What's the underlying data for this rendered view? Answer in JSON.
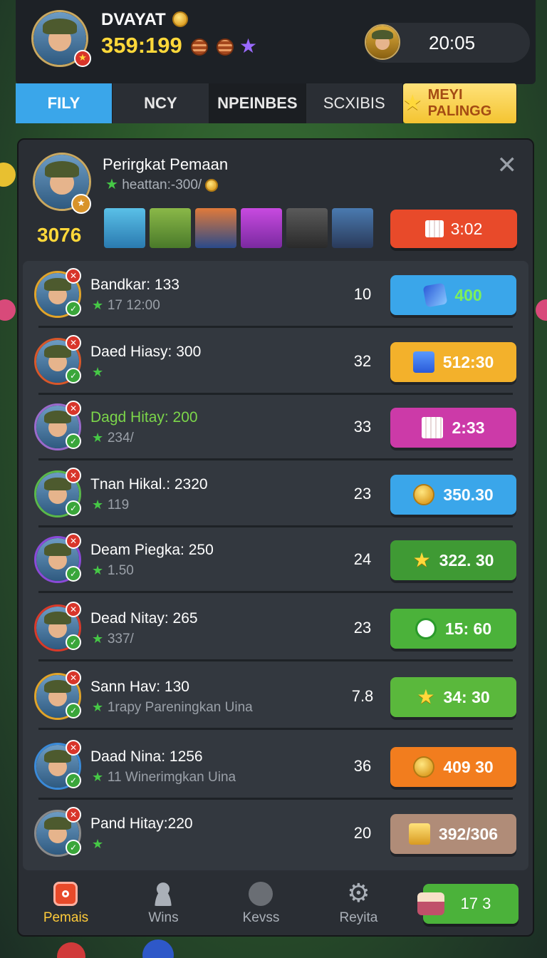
{
  "player": {
    "name": "DVAYAT",
    "balance": "359:199",
    "timer": "20:05"
  },
  "tabs": [
    {
      "label": "FILY",
      "active": true
    },
    {
      "label": "NCY"
    },
    {
      "label": "NPEINBES"
    },
    {
      "label": "SCXIBIS"
    },
    {
      "label": "MEYI PALINGG"
    }
  ],
  "panel": {
    "title": "Perirgkat Pemaan",
    "subtitle": "heattan:-300/",
    "score": "3076",
    "action_button": "3:02",
    "close_icon": "close-icon"
  },
  "rows": [
    {
      "name": "Bandkar: 133",
      "sub": "17 12:00",
      "rank": "10",
      "button": "400",
      "btn_color": "#3aa6ea",
      "icon": "diamond-card-icon",
      "ring": "#e0a42a"
    },
    {
      "name": "Daed Hiasy: 300",
      "sub": "",
      "rank": "32",
      "button": "512:30",
      "btn_color": "#f3b12b",
      "icon": "blue-cube-icon",
      "ring": "#d8572a"
    },
    {
      "name": "Dagd Hitay: 200",
      "sub": "234/",
      "rank": "33",
      "button": "2:33",
      "btn_color": "#cc3aa8",
      "icon": "calendar-icon",
      "ring": "#9a6acc",
      "name_color": "#7cd64a"
    },
    {
      "name": "Tnan Hikal.: 2320",
      "sub": "119",
      "rank": "23",
      "button": "350.30",
      "btn_color": "#3aa6ea",
      "icon": "gold-coin-icon",
      "ring": "#5ab84a"
    },
    {
      "name": "Deam Piegka: 250",
      "sub": "1.50",
      "rank": "24",
      "button": "322. 30",
      "btn_color": "#3f9a34",
      "icon": "star-icon",
      "ring": "#8a4ad8"
    },
    {
      "name": "Dead Nitay: 265",
      "sub": "337/",
      "rank": "23",
      "button": "15: 60",
      "btn_color": "#4bb23a",
      "icon": "check-circle-icon",
      "ring": "#d83a2a"
    },
    {
      "name": "Sann Hav: 130",
      "sub": "1rapy Pareningkan Uina",
      "rank": "7.8",
      "button": "34: 30",
      "btn_color": "#5ab83c",
      "icon": "star-icon",
      "ring": "#e0a42a"
    },
    {
      "name": "Daad Nina: 1256",
      "sub": "11 Winerimgkan Uina",
      "rank": "36",
      "button": "409 30",
      "btn_color": "#f27d1e",
      "icon": "gold-coin-icon",
      "ring": "#3a8ad8"
    },
    {
      "name": "Pand Hitay:220",
      "sub": "",
      "rank": "20",
      "button": "392/306",
      "btn_color": "#b08c78",
      "icon": "gold-star-badge-icon",
      "ring": "#8a8a8a"
    }
  ],
  "nav": [
    {
      "label": "Pemais",
      "active": true,
      "icon": "camera-icon"
    },
    {
      "label": "Wins",
      "icon": "person-icon"
    },
    {
      "label": "Kevss",
      "icon": "jester-icon"
    },
    {
      "label": "Reyita",
      "icon": "gear-icon"
    }
  ],
  "nav_button": "17 3"
}
